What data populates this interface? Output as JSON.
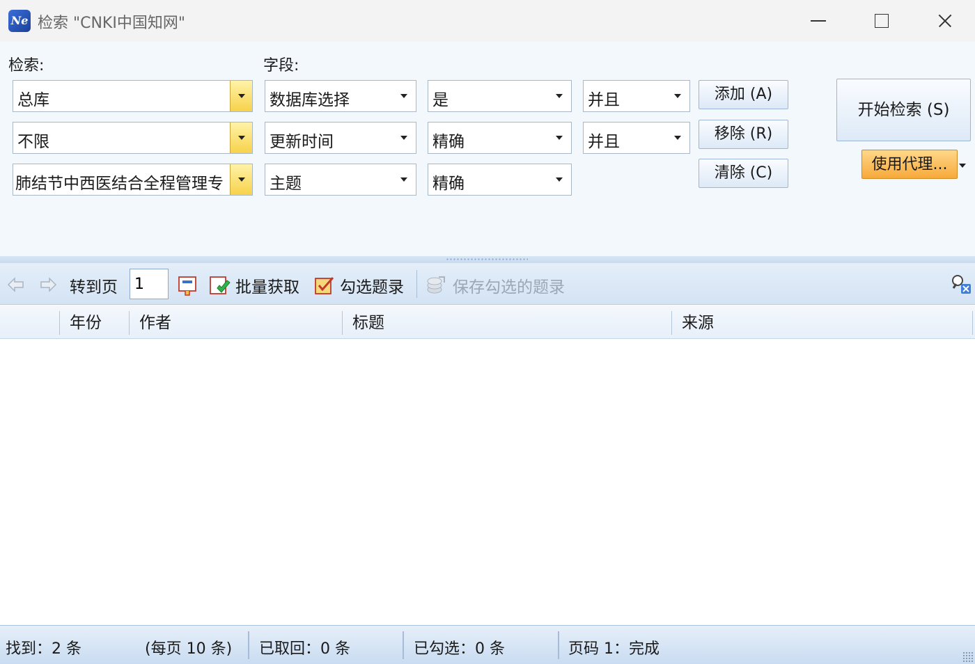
{
  "window": {
    "title": "检索 \"CNKI中国知网\"",
    "icon_text": "Ne"
  },
  "search": {
    "search_label": "检索:",
    "field_label": "字段:",
    "rows": [
      {
        "term": "总库",
        "field": "数据库选择",
        "match": "是",
        "logic": "并且"
      },
      {
        "term": "不限",
        "field": "更新时间",
        "match": "精确",
        "logic": "并且"
      },
      {
        "term": "肺结节中西医结合全程管理专",
        "field": "主题",
        "match": "精确"
      }
    ],
    "add_label": "添加 (A)",
    "remove_label": "移除 (R)",
    "clear_label": "清除 (C)",
    "start_label": "开始检索 (S)",
    "proxy_label": "使用代理..."
  },
  "toolbar": {
    "goto_label": "转到页",
    "page_value": "1",
    "batch_fetch_label": "批量获取",
    "check_records_label": "勾选题录",
    "save_checked_label": "保存勾选的题录"
  },
  "grid": {
    "columns": [
      "年份",
      "作者",
      "标题",
      "来源"
    ]
  },
  "status": {
    "found": "找到：2 条",
    "per_page": "(每页 10 条)",
    "fetched": "已取回：0 条",
    "checked": "已勾选：0 条",
    "page_status": "页码 1：完成"
  },
  "colors": {
    "accent_yellow": "#f7d24a",
    "proxy_orange": "#f7a93a",
    "panel_bg": "#f3f8fd",
    "toolbar_bg": "#d4e3f4"
  }
}
